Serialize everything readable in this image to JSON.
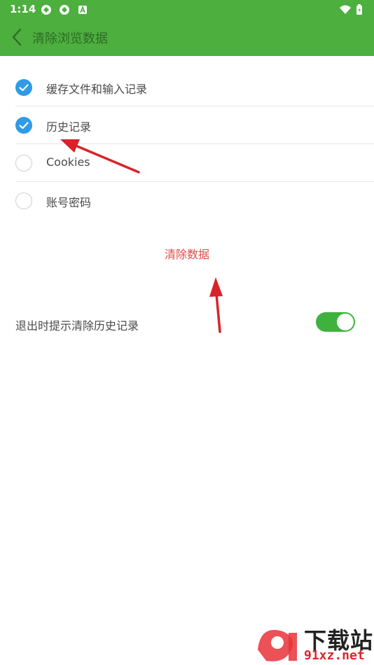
{
  "status_bar": {
    "time": "1:14"
  },
  "header": {
    "title": "清除浏览数据"
  },
  "options": [
    {
      "label": "缓存文件和输入记录",
      "checked": true
    },
    {
      "label": "历史记录",
      "checked": true
    },
    {
      "label": "Cookies",
      "checked": false
    },
    {
      "label": "账号密码",
      "checked": false
    }
  ],
  "clear_button": {
    "label": "清除数据"
  },
  "exit_prompt": {
    "label": "退出时提示清除历史记录",
    "enabled": true
  },
  "watermark": {
    "text": "下载站",
    "url": "91xz.net"
  },
  "colors": {
    "header_bg": "#4caf3e",
    "check_on": "#2f9be6",
    "clear_red": "#e64848",
    "toggle_on": "#3fb23d",
    "annotation_arrow": "#d8232a"
  }
}
